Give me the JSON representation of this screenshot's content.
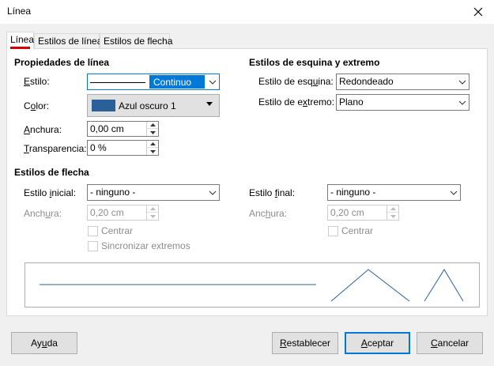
{
  "window": {
    "title": "Línea",
    "close_icon": "close-icon"
  },
  "tabs": [
    {
      "label": "Línea",
      "active": true
    },
    {
      "label": "Estilos de línea",
      "active": false
    },
    {
      "label": "Estilos de flecha",
      "active": false
    }
  ],
  "line_properties": {
    "heading": "Propiedades de línea",
    "style_label": "Estilo:",
    "style_value": "Continuo",
    "color_label": "Color:",
    "color_value": "Azul oscuro 1",
    "color_hex": "#2a6099",
    "width_label": "Anchura:",
    "width_value": "0,00 cm",
    "transparency_label": "Transparencia:",
    "transparency_value": "0 %"
  },
  "corner_styles": {
    "heading": "Estilos de esquina y extremo",
    "corner_label": "Estilo de esquina:",
    "corner_value": "Redondeado",
    "cap_label": "Estilo de extremo:",
    "cap_value": "Plano"
  },
  "arrow_styles": {
    "heading": "Estilos de flecha",
    "start_label": "Estilo inicial:",
    "start_value": "- ninguno -",
    "start_width_label": "Anchura:",
    "start_width_value": "0,20 cm",
    "start_center_label": "Centrar",
    "sync_label": "Sincronizar extremos",
    "end_label": "Estilo final:",
    "end_value": "- ninguno -",
    "end_width_label": "Anchura:",
    "end_width_value": "0,20 cm",
    "end_center_label": "Centrar"
  },
  "buttons": {
    "help": "Ayuda",
    "reset": "Restablecer",
    "ok": "Aceptar",
    "cancel": "Cancelar"
  },
  "colors": {
    "accent": "#0078d7",
    "tab_underline": "#d00000",
    "preview_line": "#2a6099"
  }
}
